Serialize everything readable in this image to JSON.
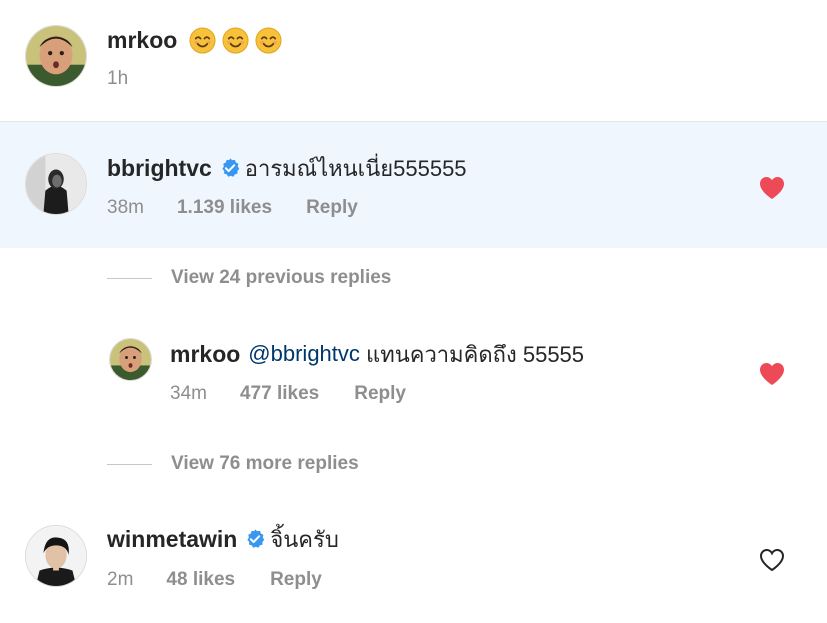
{
  "caption": {
    "username": "mrkoo",
    "emojis": [
      "smiling-face-icon",
      "smiling-face-icon",
      "smiling-face-icon"
    ],
    "time": "1h"
  },
  "comments": [
    {
      "username": "bbrightvc",
      "verified": true,
      "text": "อารมณ์ไหนเนี่ย555555",
      "time": "38m",
      "likes": "1.139 likes",
      "reply_label": "Reply",
      "liked": true
    },
    {
      "username": "winmetawin",
      "verified": true,
      "text": "จิ้นครับ",
      "time": "2m",
      "likes": "48 likes",
      "reply_label": "Reply",
      "liked": false
    }
  ],
  "thread": {
    "view_previous": "View 24 previous replies",
    "reply": {
      "username": "mrkoo",
      "mention": "@bbrightvc",
      "text": " แทนความคิดถึง 55555",
      "time": "34m",
      "likes": "477 likes",
      "reply_label": "Reply",
      "liked": true
    },
    "view_more": "View 76 more replies"
  },
  "colors": {
    "heart_liked": "#ed4956",
    "verified_badge": "#3897f0",
    "highlight_bg": "#eff6fe",
    "mention": "#00376b",
    "meta_text": "#8e8e8e"
  }
}
